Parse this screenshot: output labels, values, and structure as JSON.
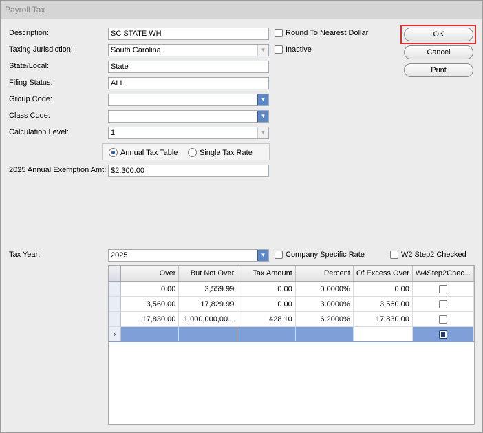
{
  "window": {
    "title": "Payroll Tax"
  },
  "form": {
    "description_label": "Description:",
    "description_value": "SC STATE WH",
    "taxing_jurisdiction_label": "Taxing Jurisdiction:",
    "taxing_jurisdiction_value": "South Carolina",
    "state_local_label": "State/Local:",
    "state_local_value": "State",
    "filing_status_label": "Filing Status:",
    "filing_status_value": "ALL",
    "group_code_label": "Group Code:",
    "group_code_value": "",
    "class_code_label": "Class Code:",
    "class_code_value": "",
    "calc_level_label": "Calculation Level:",
    "calc_level_value": "1",
    "annual_tax_table_label": "Annual Tax Table",
    "single_tax_rate_label": "Single Tax Rate",
    "exemption_label": "2025 Annual Exemption Amt:",
    "exemption_value": "$2,300.00",
    "tax_year_label": "Tax Year:",
    "tax_year_value": "2025"
  },
  "checkboxes": {
    "round_label": "Round To Nearest Dollar",
    "inactive_label": "Inactive",
    "company_specific_label": "Company Specific Rate",
    "w2_step2_label": "W2 Step2 Checked"
  },
  "buttons": {
    "ok": "OK",
    "cancel": "Cancel",
    "print": "Print"
  },
  "grid": {
    "columns": [
      "Over",
      "But Not Over",
      "Tax Amount",
      "Percent",
      "Of Excess Over",
      "W4Step2Chec..."
    ],
    "rows": [
      [
        "0.00",
        "3,559.99",
        "0.00",
        "0.0000%",
        "0.00"
      ],
      [
        "3,560.00",
        "17,829.99",
        "0.00",
        "3.0000%",
        "3,560.00"
      ],
      [
        "17,830.00",
        "1,000,000,00...",
        "428.10",
        "6.2000%",
        "17,830.00"
      ]
    ],
    "new_row_marker": "›"
  },
  "icons": {
    "dropdown": "chevron-down-icon"
  }
}
